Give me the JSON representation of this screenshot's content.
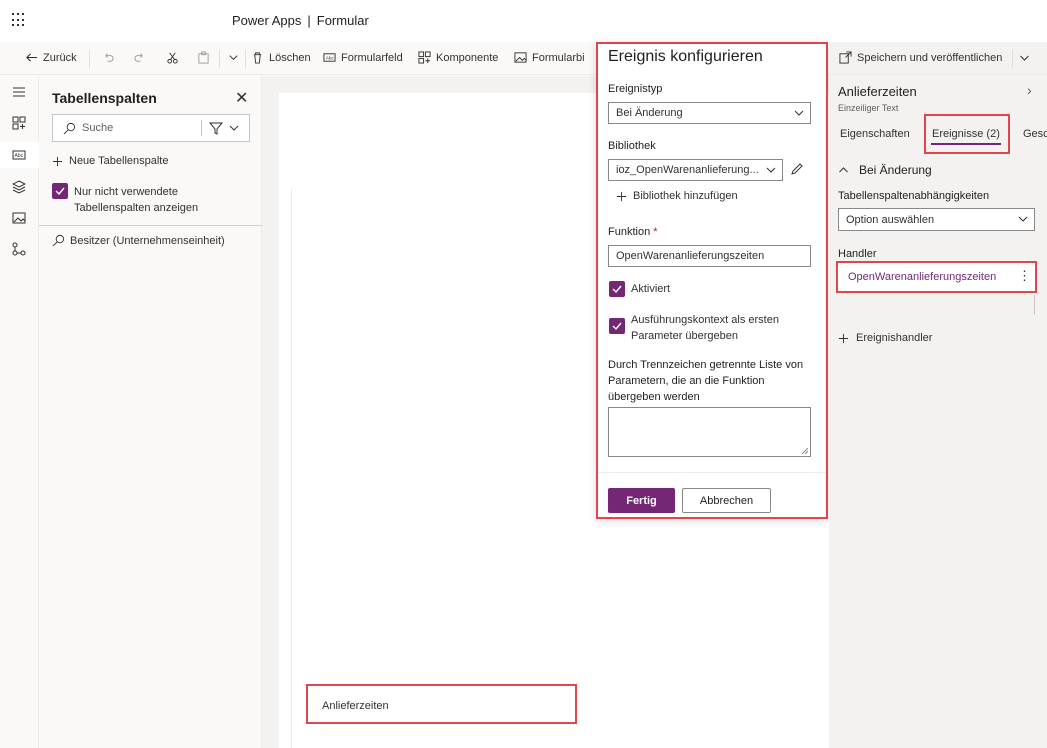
{
  "header": {
    "app_name": "Power Apps",
    "separator": "|",
    "page": "Formular"
  },
  "commandbar": {
    "back": "Zurück",
    "delete": "Löschen",
    "form_field": "Formularfeld",
    "component": "Komponente",
    "form_library": "Formularbi",
    "save_publish": "Speichern und veröffentlichen"
  },
  "columns_panel": {
    "title": "Tabellenspalten",
    "search_placeholder": "Suche",
    "new_column": "Neue Tabellenspalte",
    "unused_only": "Nur nicht verwendete Tabellenspalten anzeigen",
    "items": [
      {
        "label": "Besitzer (Unternehmenseinheit)"
      }
    ]
  },
  "canvas": {
    "field_label": "Anlieferzeiten"
  },
  "dialog": {
    "title": "Ereignis konfigurieren",
    "event_type_label": "Ereignistyp",
    "event_type_value": "Bei Änderung",
    "library_label": "Bibliothek",
    "library_value": "ioz_OpenWarenanlieferung...",
    "add_library": "Bibliothek hinzufügen",
    "function_label": "Funktion",
    "required_marker": "*",
    "function_value": "OpenWarenanlieferungszeiten",
    "enabled_label": "Aktiviert",
    "enabled": true,
    "pass_context_label": "Ausführungskontext als ersten Parameter übergeben",
    "pass_context": true,
    "params_label": "Durch Trennzeichen getrennte Liste von Parametern, die an die Funktion übergeben werden",
    "params_value": "",
    "done": "Fertig",
    "cancel": "Abbrechen"
  },
  "properties_panel": {
    "title": "Anlieferzeiten",
    "subtitle": "Einzeiliger Text",
    "tabs": [
      {
        "label": "Eigenschaften"
      },
      {
        "label": "Ereignisse (2)"
      },
      {
        "label": "Gesc"
      }
    ],
    "active_tab": "Ereignisse (2)",
    "section": "Bei Änderung",
    "dependencies_label": "Tabellenspaltenabhängigkeiten",
    "dependencies_placeholder": "Option auswählen",
    "handler_label": "Handler",
    "handler_value": "OpenWarenanlieferungszeiten",
    "add_handler": "Ereignishandler"
  },
  "colors": {
    "accent": "#742774",
    "highlight_border": "#e0474c",
    "canvas_bg": "#f3f2f1"
  }
}
